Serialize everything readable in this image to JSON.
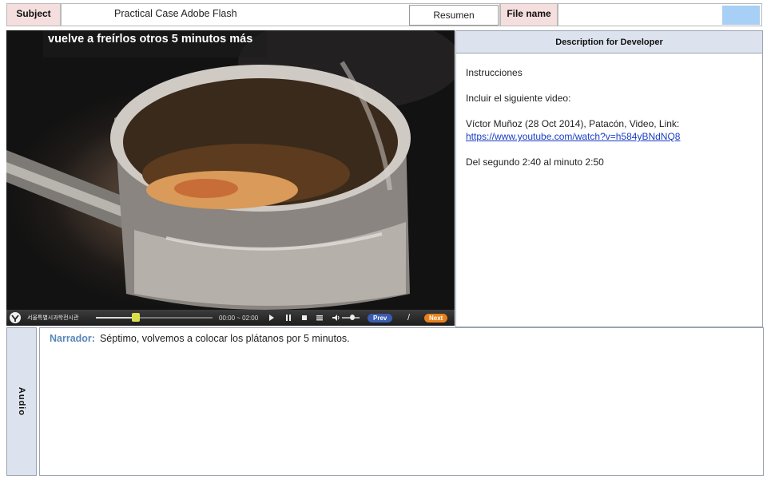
{
  "header": {
    "subject_label": "Subject",
    "subject_value": "Practical Case Adobe Flash",
    "resumen_label": "Resumen",
    "file_name_label": "File name"
  },
  "video": {
    "caption": "vuelve a freírlos otros 5 minutos más",
    "controls": {
      "time": "00:00 ~ 02:00",
      "prev_label": "Prev",
      "next_label": "Next",
      "separator": "/",
      "logo_text": "서울특별시과학전시관",
      "progress": 0.34
    }
  },
  "description": {
    "title": "Description for Developer",
    "line1": "Instrucciones",
    "line2": "Incluir el siguiente video:",
    "line3": "Víctor Muñoz (28 Oct 2014), Patacón, Video, Link:",
    "link": "https://www.youtube.com/watch?v=h584yBNdNQ8",
    "line4": "Del segundo 2:40 al minuto 2:50"
  },
  "audio": {
    "side_label": "Audio",
    "narrator_label": "Narrador:",
    "narration": "Séptimo, volvemos a colocar los plátanos por 5 minutos."
  },
  "colors": {
    "header_label_bg": "#f4dede",
    "panel_header_bg": "#dde3ee",
    "accent_blue_box": "#a8cff5",
    "narrator_color": "#5a86b8",
    "next_button": "#e8801a",
    "prev_button": "#3a5db0"
  }
}
